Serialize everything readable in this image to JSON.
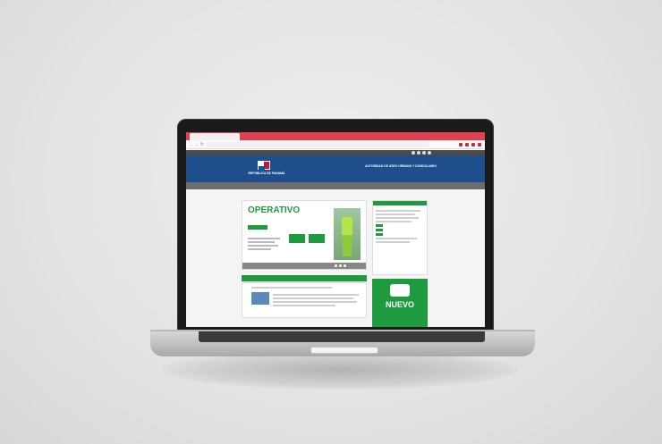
{
  "browser": {
    "tab_title": "",
    "url": ""
  },
  "site": {
    "topstrip_text": "",
    "government_name": "REPÚBLICA DE PANAMÁ",
    "government_sub": "",
    "agency_name": "AUTORIDAD DE ASEO URBANO Y DOMICILIARIO",
    "menu_items": [
      "",
      "",
      "",
      "",
      "",
      "",
      "",
      ""
    ],
    "subtabs": [
      "",
      "",
      ""
    ],
    "hero": {
      "title": "OPERATIVO",
      "subtitle": "",
      "place": ""
    },
    "sidebar_heading": "",
    "sidebar_twitter": "",
    "news_heading": "",
    "promo_label": "NUEVO"
  }
}
